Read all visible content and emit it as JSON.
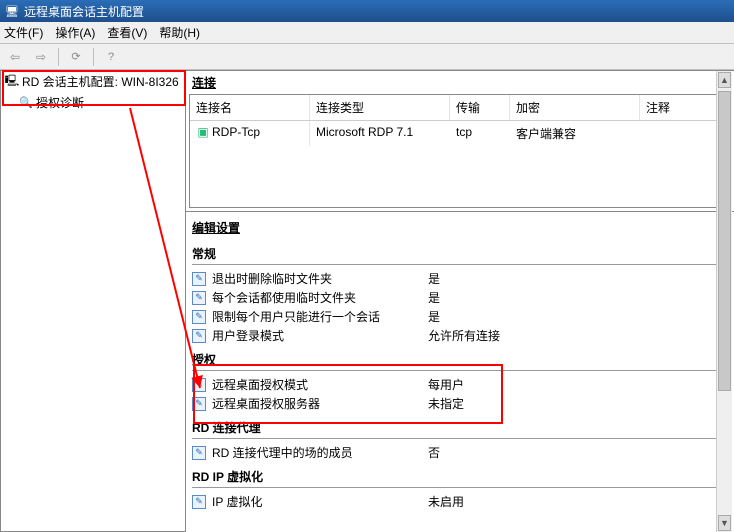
{
  "window": {
    "title": "远程桌面会话主机配置"
  },
  "menu": {
    "file": "文件(F)",
    "action": "操作(A)",
    "view": "查看(V)",
    "help": "帮助(H)"
  },
  "tree": {
    "root": "RD 会话主机配置: WIN-8I326",
    "child": "授权诊断"
  },
  "connections": {
    "heading": "连接",
    "columns": {
      "name": "连接名",
      "type": "连接类型",
      "transport": "传输",
      "encryption": "加密",
      "note": "注释"
    },
    "rows": [
      {
        "name": "RDP-Tcp",
        "type": "Microsoft RDP 7.1",
        "transport": "tcp",
        "encryption": "客户端兼容",
        "note": ""
      }
    ]
  },
  "settings": {
    "heading": "编辑设置",
    "groups": {
      "general": {
        "label": "常规",
        "items": [
          {
            "label": "退出时删除临时文件夹",
            "value": "是"
          },
          {
            "label": "每个会话都使用临时文件夹",
            "value": "是"
          },
          {
            "label": "限制每个用户只能进行一个会话",
            "value": "是"
          },
          {
            "label": "用户登录模式",
            "value": "允许所有连接"
          }
        ]
      },
      "license": {
        "label": "授权",
        "items": [
          {
            "label": "远程桌面授权模式",
            "value": "每用户"
          },
          {
            "label": "远程桌面授权服务器",
            "value": "未指定"
          }
        ]
      },
      "broker": {
        "label": "RD 连接代理",
        "items": [
          {
            "label": "RD 连接代理中的场的成员",
            "value": "否"
          }
        ]
      },
      "ipvirt": {
        "label": "RD IP 虚拟化",
        "items": [
          {
            "label": "IP 虚拟化",
            "value": "未启用"
          }
        ]
      }
    }
  }
}
